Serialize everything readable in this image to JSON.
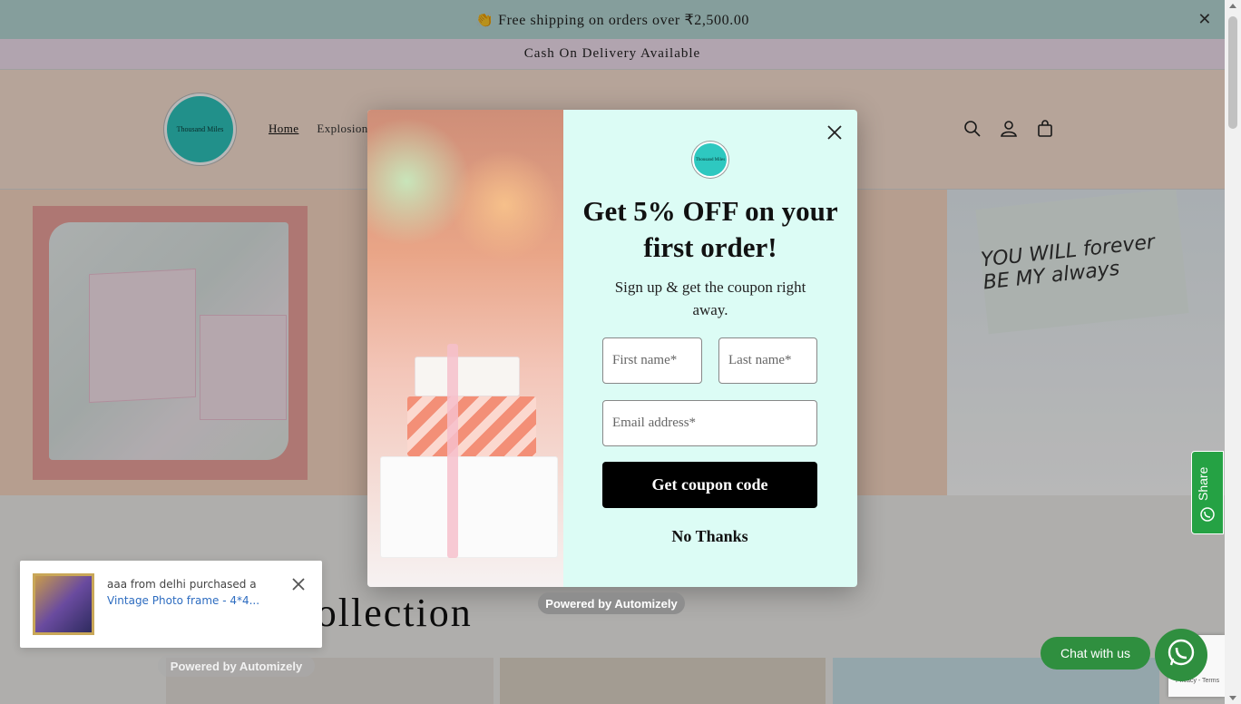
{
  "announcement": {
    "shipping_text": "👏 Free shipping on orders over ₹2,500.00",
    "close_symbol": "✕",
    "cod_text": "Cash On Delivery Available"
  },
  "header": {
    "logo_text": "Thousand Miles",
    "nav": [
      "Home",
      "Explosion"
    ],
    "icons": [
      "search-icon",
      "account-icon",
      "cart-icon"
    ]
  },
  "hero": {
    "card_text": "YOU WILL forever BE MY always"
  },
  "collection": {
    "title": "l collection"
  },
  "popup": {
    "title": "Get 5% OFF on your first order!",
    "subtitle": "Sign up & get the coupon right away.",
    "first_name_placeholder": "First name*",
    "last_name_placeholder": "Last name*",
    "email_placeholder": "Email address*",
    "submit_label": "Get coupon code",
    "dismiss_label": "No Thanks",
    "logo_text": "Thousand Miles"
  },
  "powered": {
    "label": "Powered by Automizely"
  },
  "toast": {
    "text": "aaa from delhi purchased a",
    "product_link": "Vintage Photo frame - 4*4...",
    "powered_label": "Powered by Automizely"
  },
  "share": {
    "label": "Share"
  },
  "chat": {
    "label": "Chat with us"
  },
  "recaptcha": {
    "label": "Privacy - Terms"
  },
  "colors": {
    "announce_bg": "#b9dcd8",
    "cod_bg": "#f6e3f3",
    "header_bg": "#fde4d4",
    "popup_bg": "#dcfcf5",
    "whatsapp_green": "#2f8f3f",
    "logo_teal": "#2ec8c0"
  }
}
